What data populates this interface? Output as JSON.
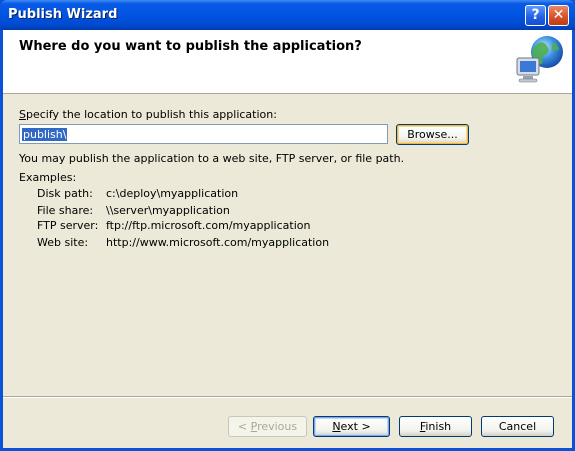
{
  "window": {
    "title": "Publish Wizard",
    "help_label": "?",
    "close_label": "✕"
  },
  "header": {
    "heading": "Where do you want to publish the application?"
  },
  "location": {
    "label_prefix": "",
    "label_mnemonic": "S",
    "label_rest": "pecify the location to publish this application:",
    "value": "publish\\",
    "browse_label": "Browse..."
  },
  "info_text": "You may publish the application to a web site, FTP server, or file path.",
  "examples": {
    "title": "Examples:",
    "rows": [
      {
        "kind": "Disk path:",
        "value": "c:\\deploy\\myapplication"
      },
      {
        "kind": "File share:",
        "value": "\\\\server\\myapplication"
      },
      {
        "kind": "FTP server:",
        "value": "ftp://ftp.microsoft.com/myapplication"
      },
      {
        "kind": "Web site:",
        "value": "http://www.microsoft.com/myapplication"
      }
    ]
  },
  "buttons": {
    "previous_prefix": "< ",
    "previous_mnemonic": "P",
    "previous_rest": "revious",
    "next_mnemonic": "N",
    "next_rest": "ext >",
    "finish_mnemonic": "F",
    "finish_rest": "inish",
    "cancel": "Cancel"
  }
}
